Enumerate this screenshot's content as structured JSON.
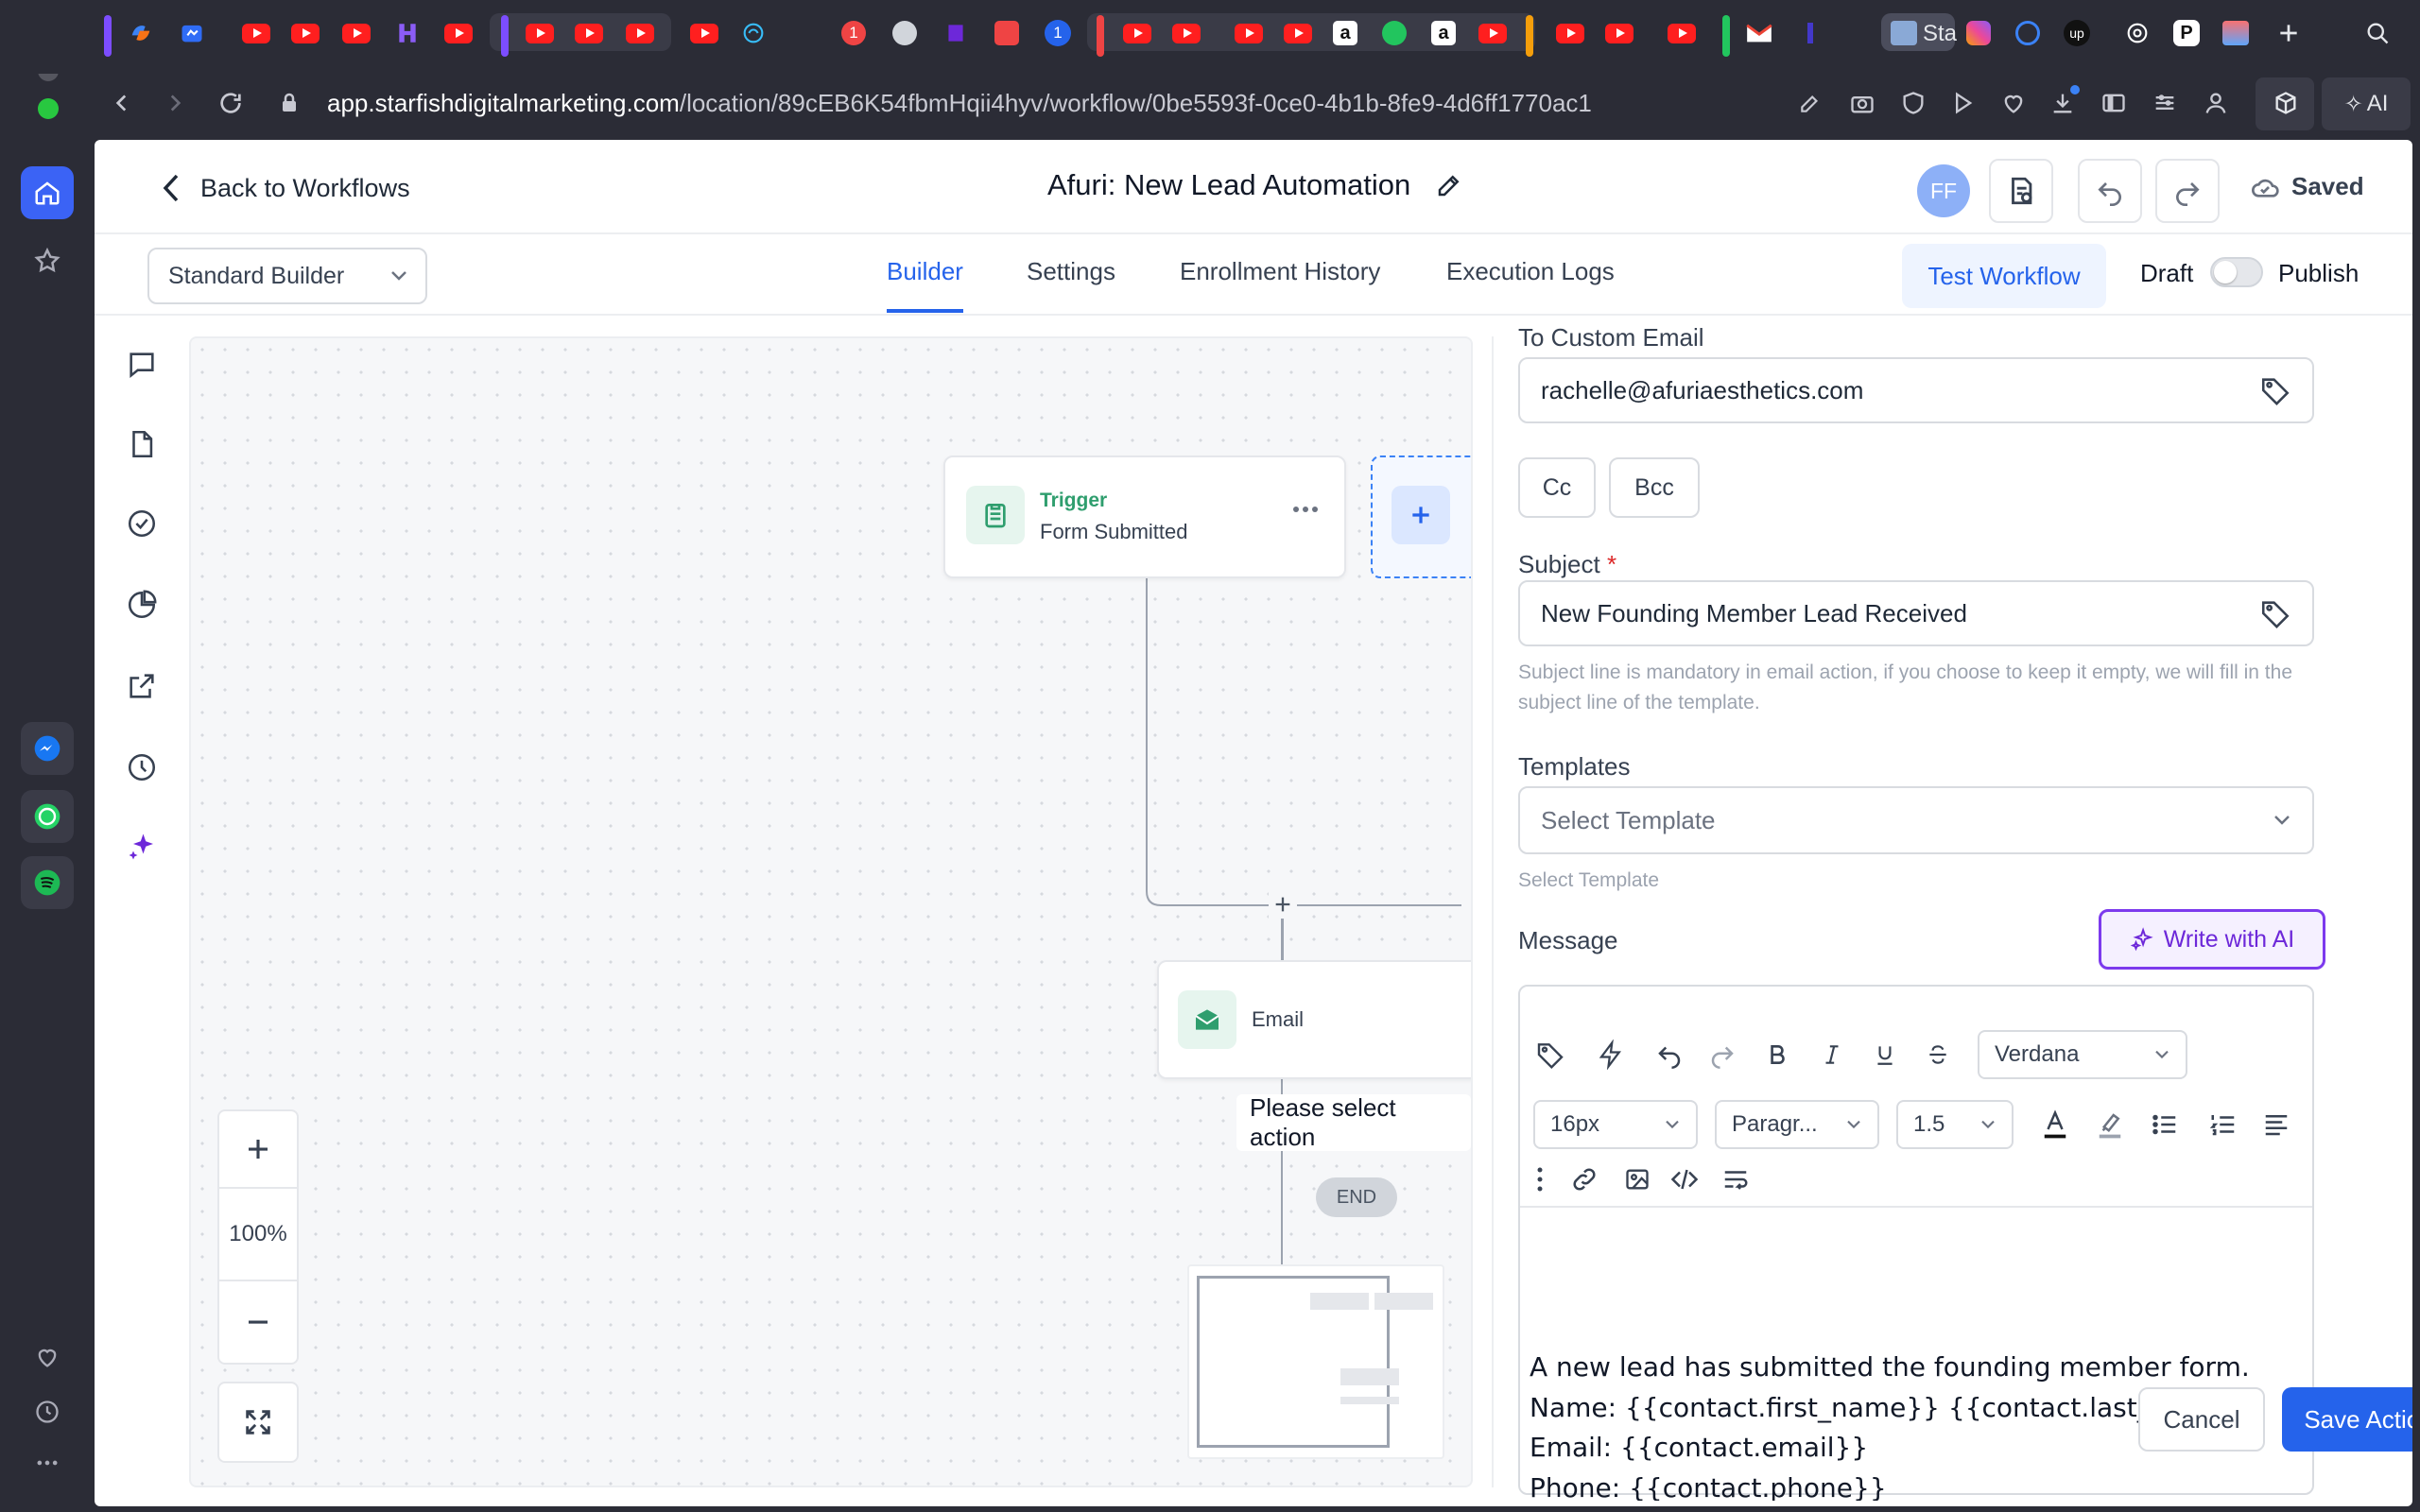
{
  "browser": {
    "url_host": "app.starfishdigitalmarketing.com",
    "url_path": "/location/89cEB6K54fbmHqii4hyv/workflow/0be5593f-0ce0-4b1b-8fe9-4d6ff1770ac1",
    "active_tab_label": "Sta",
    "ai_label": "AI",
    "badge_count": "1"
  },
  "header": {
    "back_label": "Back to Workflows",
    "workflow_title": "Afuri: New Lead Automation",
    "avatar_initials": "FF",
    "saved_label": "Saved"
  },
  "subheader": {
    "builder_select": "Standard Builder",
    "tabs": [
      "Builder",
      "Settings",
      "Enrollment History",
      "Execution Logs"
    ],
    "active_tab": "Builder",
    "test_workflow": "Test Workflow",
    "draft_label": "Draft",
    "publish_label": "Publish"
  },
  "canvas": {
    "trigger_title": "Trigger",
    "trigger_sub": "Form Submitted",
    "email_node": "Email",
    "tooltip": "Please select action",
    "end_label": "END",
    "zoom_level": "100%"
  },
  "panel": {
    "to_custom_email_label": "To Custom Email",
    "to_custom_email_value": "rachelle@afuriaesthetics.com",
    "cc_label": "Cc",
    "bcc_label": "Bcc",
    "subject_label": "Subject",
    "subject_required": "*",
    "subject_value": "New Founding Member Lead Received",
    "subject_help": "Subject line is mandatory in email action, if you choose to keep it empty, we will fill in the subject line of the template.",
    "templates_label": "Templates",
    "templates_placeholder": "Select Template",
    "templates_help": "Select Template",
    "message_label": "Message",
    "write_ai_label": "Write with AI",
    "font_family": "Verdana",
    "font_size": "16px",
    "block_type": "Paragr...",
    "line_height": "1.5",
    "message_lines": [
      "A new lead has submitted the founding member form.",
      "Name: {{contact.first_name}} {{contact.last_name}}",
      "Email: {{contact.email}}",
      "Phone: {{contact.phone}}"
    ],
    "cancel_label": "Cancel",
    "save_label": "Save Action"
  },
  "colors": {
    "accent": "#2563eb",
    "ai_purple": "#7c3aed",
    "trigger_green": "#2f9e6e"
  }
}
